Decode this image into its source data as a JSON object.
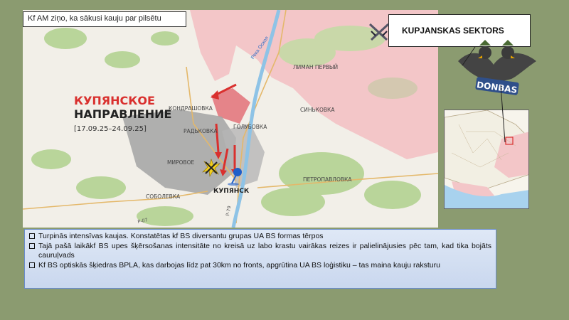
{
  "title": "Kf AM ziņo, ka sākusi kauju par pilsētu",
  "sector_label": "KUPJANSKAS SEKTORS",
  "logo_text": "DONBAS",
  "map": {
    "heading_line1": "КУПЯНСКОЕ",
    "heading_line2": "НАПРАВЛЕНИЕ",
    "date_range": "[17.09.25–24.09.25]",
    "river": "Река Оскол",
    "places": {
      "kondrashovka": "КОНДРАШОВКА",
      "radkovka": "РАДЬКОВКА",
      "golubovka": "ГОЛУБОВКА",
      "sinkovka": "СИНЬКОВКА",
      "liman": "ЛИМАН ПЕРВЫЙ",
      "mirovoe": "МИРОВОЕ",
      "sobolevka": "СОБОЛЕВКА",
      "kupyansk": "КУПЯНСК",
      "petropavlovka": "ПЕТРОПАВЛОВКА"
    }
  },
  "notes": [
    "Turpinās intensīvas kaujas. Konstatētas kf BS diversantu grupas UA BS formas tērpos",
    "Tajā pašā laikākf BS upes šķērsošanas intensitāte no kreisā uz labo krastu vairākas reizes ir palielinājusies pēc tam, kad tika bojāts cauruļvads",
    "Kf BS optiskās šķiedras BPLA, kas darbojas līdz pat 30km no fronts, apgrūtina UA BS loģistiku – tas maina kauju raksturu"
  ],
  "colors": {
    "russian_controlled": "#f3c6c8",
    "contested": "#9e9e9e",
    "attack_arrow": "#d9302e",
    "river": "#8ec3e6",
    "forest": "#b9d59a"
  },
  "icons": [
    "crossed-swords-icon",
    "push-pin-icon",
    "explosion-icon",
    "double-headed-eagle-icon"
  ]
}
